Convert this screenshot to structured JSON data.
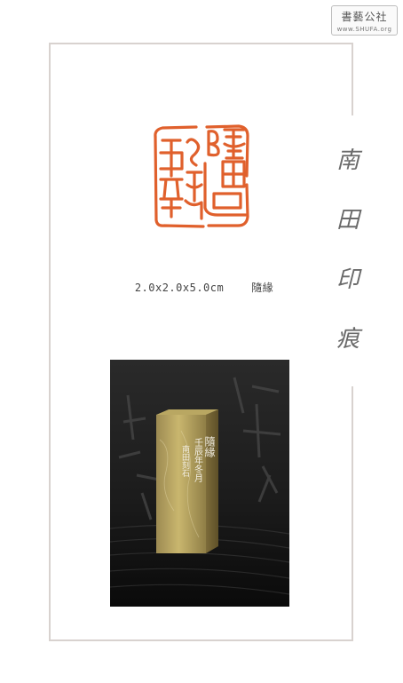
{
  "watermark": {
    "title": "書藝公社",
    "url": "www.SHUFA.org"
  },
  "side_title": {
    "chars": [
      "南",
      "田",
      "印",
      "痕"
    ]
  },
  "seal": {
    "image_name": "red-seal-impression",
    "text": "隨緣",
    "color": "#e0602c"
  },
  "caption": {
    "dimensions": "2.0x2.0x5.0cm",
    "name": "隨緣"
  },
  "photo": {
    "image_name": "carved-stone-seal-photo",
    "inscription_line1": "隨緣",
    "inscription_line2": "壬辰年冬月",
    "inscription_line3": "南田刻石"
  }
}
